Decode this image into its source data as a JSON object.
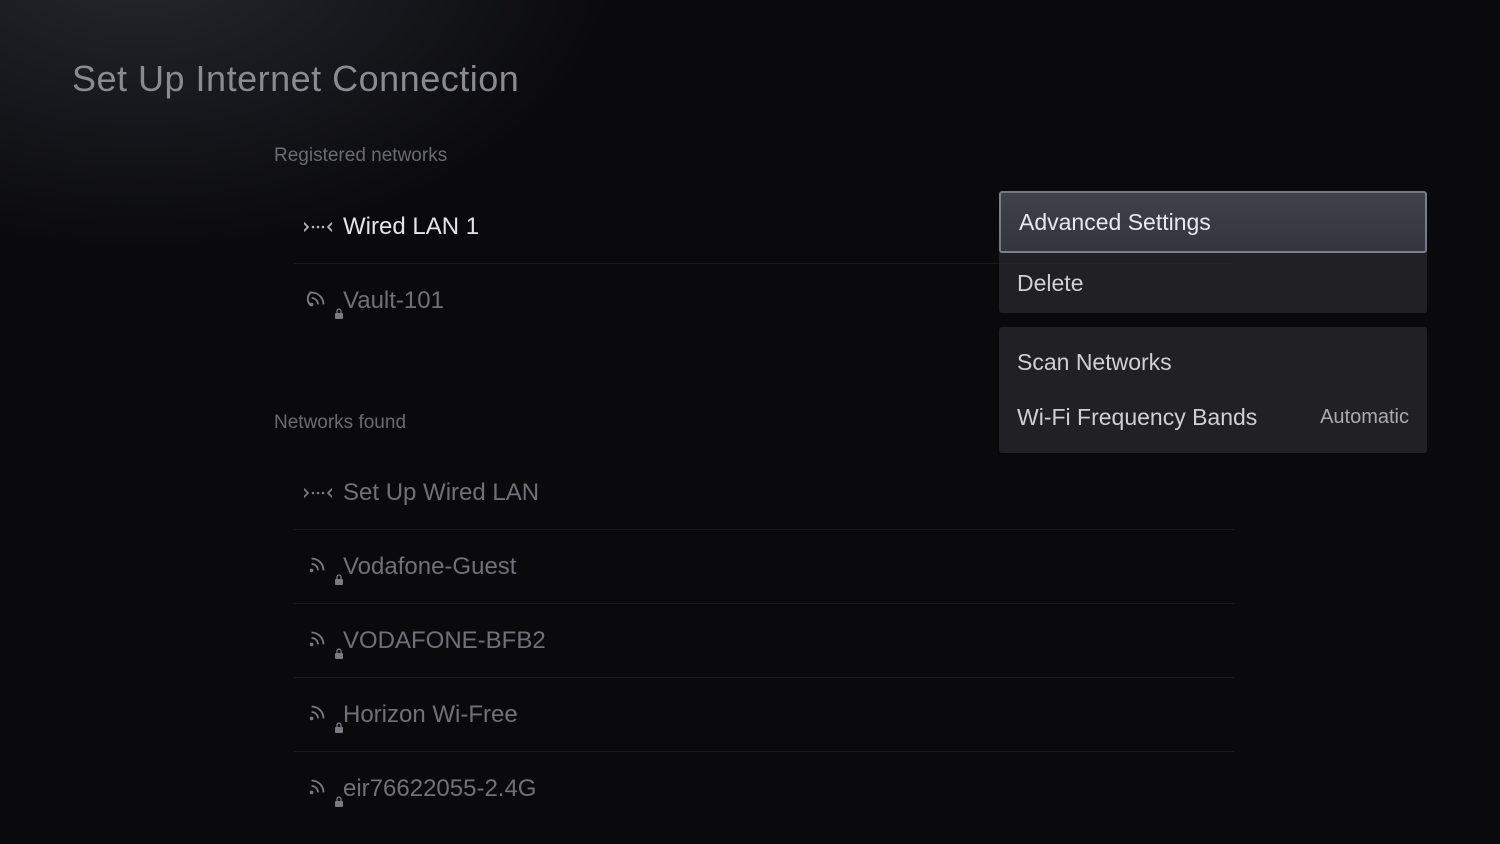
{
  "page": {
    "title": "Set Up Internet Connection"
  },
  "sections": {
    "registered_label": "Registered networks",
    "found_label": "Networks found"
  },
  "registered": [
    {
      "label": "Wired LAN 1",
      "type": "wired",
      "locked": false,
      "active": true
    },
    {
      "label": "Vault-101",
      "type": "wifi",
      "locked": true,
      "active": false
    }
  ],
  "found": [
    {
      "label": "Set Up Wired LAN",
      "type": "wired",
      "locked": false
    },
    {
      "label": "Vodafone-Guest",
      "type": "wifi",
      "locked": true
    },
    {
      "label": "VODAFONE-BFB2",
      "type": "wifi",
      "locked": true
    },
    {
      "label": "Horizon Wi-Free",
      "type": "wifi",
      "locked": true
    },
    {
      "label": "eir76622055-2.4G",
      "type": "wifi",
      "locked": true
    }
  ],
  "context_menu": {
    "group1": [
      {
        "label": "Advanced Settings",
        "highlighted": true
      },
      {
        "label": "Delete",
        "highlighted": false
      }
    ],
    "group2": [
      {
        "label": "Scan Networks",
        "value": ""
      },
      {
        "label": "Wi-Fi Frequency Bands",
        "value": "Automatic"
      }
    ]
  }
}
